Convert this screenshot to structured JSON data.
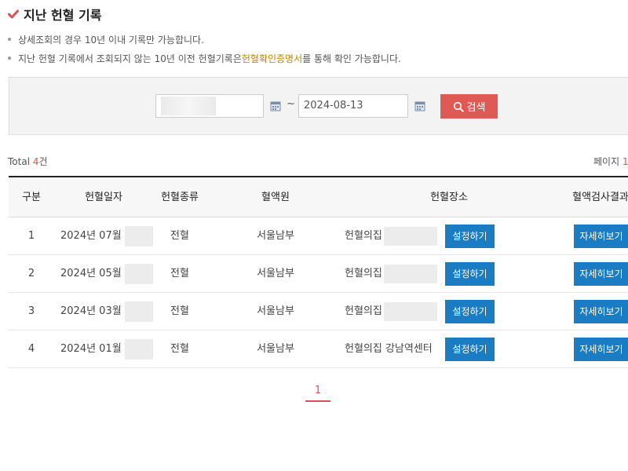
{
  "page_title": "지난 헌혈 기록",
  "notes": {
    "line1": "상세조회의 경우 10년 이내 기록만 가능합니다.",
    "line2_pre": "지난 헌혈 기록에서 조회되지 않는 10년 이전 헌혈기록은 ",
    "line2_highlight": "헌혈확인증명서",
    "line2_post": "를 통해 확인 가능합니다."
  },
  "search": {
    "tilde": "~",
    "to_date": "2024-08-13",
    "button_label": "검색"
  },
  "summary": {
    "total_prefix": "Total ",
    "total_count": "4",
    "total_suffix": "건",
    "page_prefix": "페이지 ",
    "page_current": "1"
  },
  "table": {
    "headers": [
      "구분",
      "헌혈일자",
      "헌혈종류",
      "혈액원",
      "헌혈장소",
      "혈액검사결과"
    ],
    "rows": [
      {
        "no": "1",
        "date": "2024년 07월",
        "type": "전혈",
        "center": "서울남부",
        "place": "헌혈의집",
        "set_label": "설정하기",
        "detail_label": "자세히보기"
      },
      {
        "no": "2",
        "date": "2024년 05월",
        "type": "전혈",
        "center": "서울남부",
        "place": "헌혈의집",
        "set_label": "설정하기",
        "detail_label": "자세히보기"
      },
      {
        "no": "3",
        "date": "2024년 03월",
        "type": "전혈",
        "center": "서울남부",
        "place": "헌혈의집",
        "set_label": "설정하기",
        "detail_label": "자세히보기"
      },
      {
        "no": "4",
        "date": "2024년 01월",
        "type": "전혈",
        "center": "서울남부",
        "place": "헌혈의집 강남역센터",
        "set_label": "설정하기",
        "detail_label": "자세히보기"
      }
    ]
  },
  "pagination": {
    "current": "1"
  },
  "colors": {
    "accent_red": "#d9534f",
    "button_blue": "#1a7dc4",
    "highlight": "#b8860b"
  }
}
